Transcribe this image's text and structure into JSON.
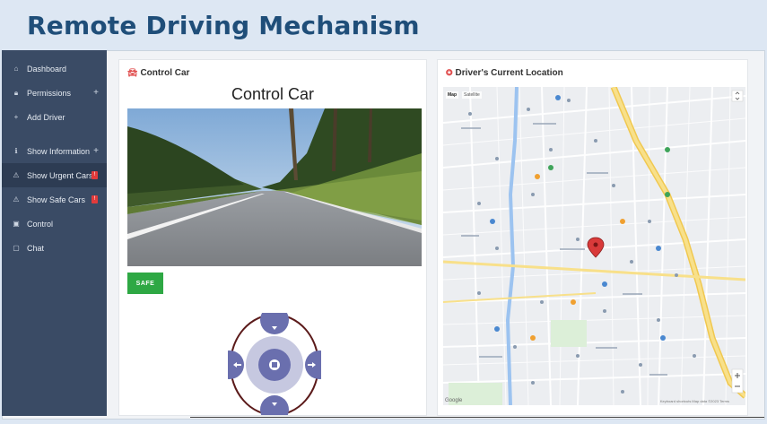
{
  "slide": {
    "title": "Remote Driving Mechanism"
  },
  "sidebar": {
    "items": [
      {
        "label": "Dashboard",
        "icon": "home-icon",
        "glyph": "⌂"
      },
      {
        "label": "Permissions",
        "icon": "lock-icon",
        "glyph": "🔒︎",
        "expand": "+"
      },
      {
        "label": "Add Driver",
        "icon": "plus-icon",
        "glyph": "+"
      },
      {
        "label": "Show Information",
        "icon": "info-icon",
        "glyph": "ℹ",
        "expand": "+"
      },
      {
        "label": "Show Urgent Cars",
        "icon": "warning-icon",
        "glyph": "⚠",
        "badge": "!"
      },
      {
        "label": "Show Safe Cars",
        "icon": "warning-icon",
        "glyph": "⚠",
        "badge": "!"
      },
      {
        "label": "Control",
        "icon": "monitor-icon",
        "glyph": "▣"
      },
      {
        "label": "Chat",
        "icon": "chat-icon",
        "glyph": "▢"
      }
    ],
    "active_index": 4
  },
  "control_card": {
    "header": "Control Car",
    "header_icon": "car-icon",
    "heading": "Control Car",
    "safe_button": "SAFE",
    "accent_green": "#2ea844"
  },
  "map_card": {
    "header": "Driver's Current Location",
    "header_icon": "map-pin-icon",
    "tabs": [
      "Map",
      "Satellite"
    ],
    "google": "Google",
    "footer": "Keyboard shortcuts   Map data ©2023   Terms",
    "road_color": "#f5d86a",
    "water_color": "#9cc3f0"
  },
  "colors": {
    "title": "#1f4e79",
    "sidebar": "#3a4b65",
    "badge": "#e23b3b",
    "joystick": "#6a6fae"
  }
}
